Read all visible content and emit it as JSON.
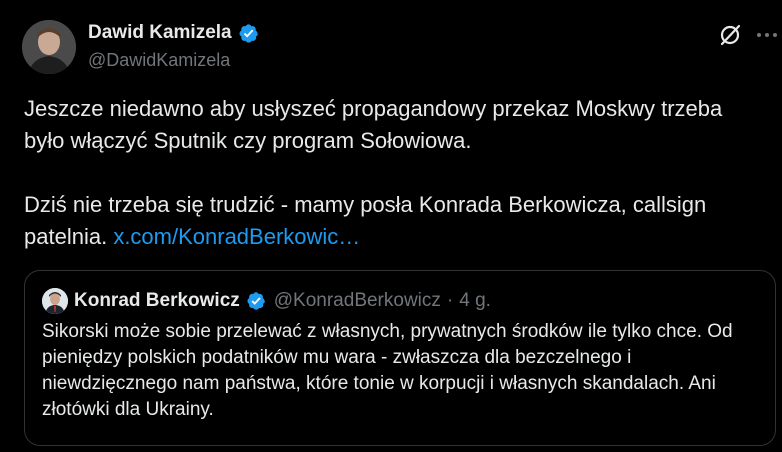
{
  "author": {
    "display_name": "Dawid Kamizela",
    "handle": "@DawidKamizela",
    "verified": true
  },
  "tweet": {
    "paragraph1": "Jeszcze niedawno aby usłyszeć propagandowy przekaz Moskwy trzeba było włączyć Sputnik czy program Sołowiowa.",
    "paragraph2_text": "Dziś nie trzeba się trudzić - mamy posła Konrada Berkowicza, callsign patelnia.",
    "paragraph2_link": "x.com/KonradBerkowic…"
  },
  "quoted_tweet": {
    "display_name": "Konrad Berkowicz",
    "handle": "@KonradBerkowicz",
    "separator": "·",
    "time": "4 g.",
    "text": "Sikorski może sobie przelewać z własnych, prywatnych środków ile tylko chce. Od pieniędzy polskich podatników mu wara - zwłaszcza dla bezczelnego i niewdzięcznego nam państwa, które tonie w korpucji i własnych skandalach. Ani złotówki dla Ukrainy."
  },
  "colors": {
    "background": "#000000",
    "text": "#e7e9ea",
    "secondary_text": "#71767b",
    "link": "#1d9bf0",
    "verified_badge": "#1d9bf0",
    "border": "#2f3336"
  },
  "icons": [
    "verified-badge-icon",
    "grok-icon",
    "more-options-icon"
  ]
}
